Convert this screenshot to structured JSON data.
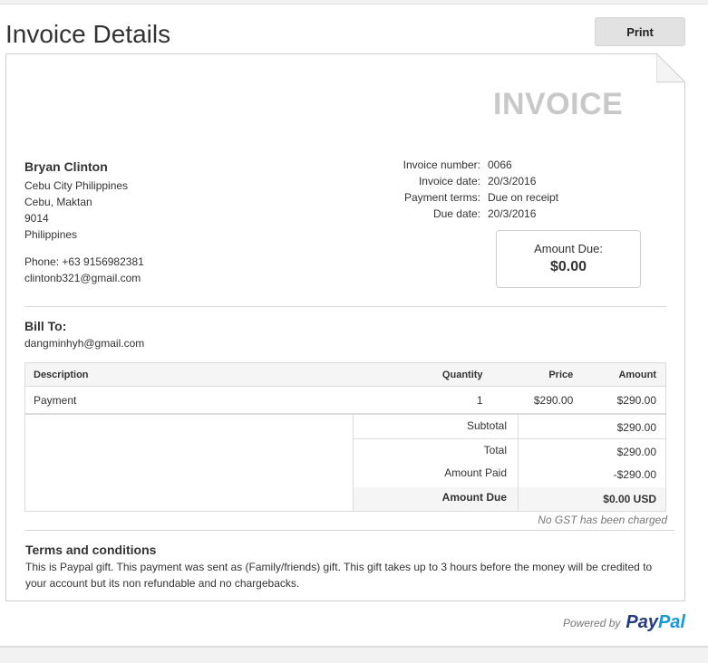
{
  "page": {
    "title": "Invoice Details",
    "print_label": "Print"
  },
  "invoice": {
    "heading": "INVOICE",
    "merchant": {
      "name": "Bryan Clinton",
      "address_lines": [
        "Cebu City Philippines",
        "Cebu, Maktan",
        "9014",
        "Philippines"
      ],
      "phone": "Phone: +63 9156982381",
      "email": "clintonb321@gmail.com"
    },
    "meta": [
      {
        "label": "Invoice number:",
        "value": "0066"
      },
      {
        "label": "Invoice date:",
        "value": "20/3/2016"
      },
      {
        "label": "Payment terms:",
        "value": "Due on receipt"
      },
      {
        "label": "Due date:",
        "value": "20/3/2016"
      }
    ],
    "amount_due_label": "Amount Due:",
    "amount_due_value": "$0.00",
    "bill_to_label": "Bill To:",
    "bill_to_email": "dangminhyh@gmail.com",
    "columns": [
      "Description",
      "Quantity",
      "Price",
      "Amount"
    ],
    "items": [
      {
        "description": "Payment",
        "quantity": "1",
        "price": "$290.00",
        "amount": "$290.00"
      }
    ],
    "totals": {
      "subtotal_label": "Subtotal",
      "subtotal": "$290.00",
      "total_label": "Total",
      "total": "$290.00",
      "paid_label": "Amount Paid",
      "paid": "-$290.00",
      "due_label": "Amount Due",
      "due": "$0.00 USD"
    },
    "gst_note": "No GST has been charged",
    "terms_label": "Terms and conditions",
    "terms_text": "This is Paypal gift. This payment was sent as (Family/friends) gift. This gift takes up to 3 hours before the money will be credited to your account but its non refundable and no chargebacks."
  },
  "footer": {
    "powered_by": "Powered by",
    "logo_part1": "Pay",
    "logo_part2": "Pal"
  }
}
